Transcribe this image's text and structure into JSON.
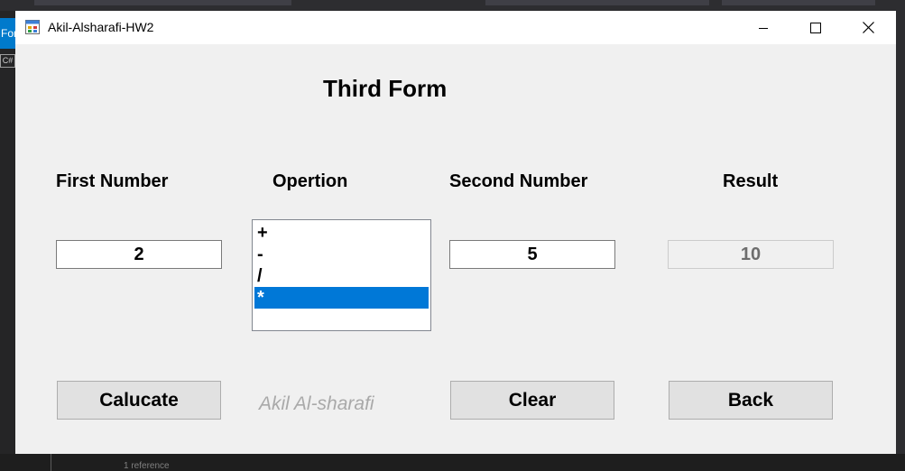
{
  "window": {
    "title": "Akil-Alsharafi-HW2",
    "controls": [
      "minimize-icon",
      "maximize-icon",
      "close-icon"
    ]
  },
  "ide": {
    "left_tab_text": "For",
    "language_badge": "C#",
    "reference_hint": "1 reference"
  },
  "form": {
    "title": "Third Form",
    "labels": {
      "first_number": "First Number",
      "operation": "Opertion",
      "second_number": "Second Number",
      "result": "Result"
    },
    "first_number_value": "2",
    "second_number_value": "5",
    "result_value": "10",
    "operations": [
      {
        "label": "+",
        "selected": false
      },
      {
        "label": "-",
        "selected": false
      },
      {
        "label": "/",
        "selected": false
      },
      {
        "label": "*",
        "selected": true
      }
    ],
    "buttons": {
      "calculate": "Calucate",
      "clear": "Clear",
      "back": "Back"
    },
    "signature": "Akil Al-sharafi"
  },
  "colors": {
    "selection": "#0078d7",
    "form_background": "#f0f0f0",
    "ide_accent": "#007acc"
  }
}
